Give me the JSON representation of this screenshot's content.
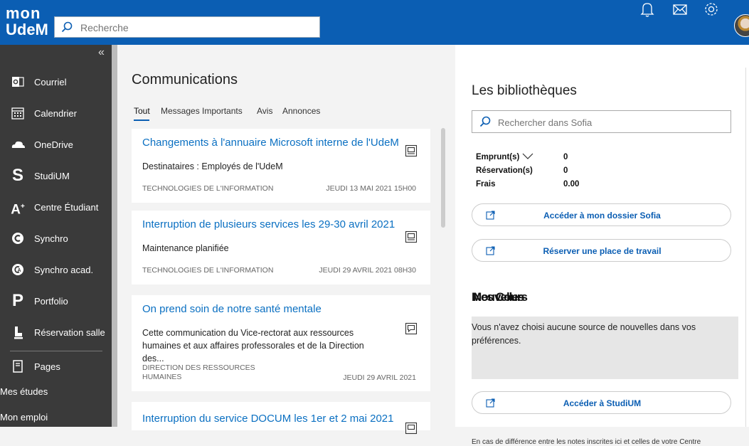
{
  "header": {
    "logo_line1": "mon",
    "logo_line2": "UdeM",
    "search_placeholder": "Recherche",
    "icons": [
      "bell-icon",
      "mail-icon",
      "gear-icon"
    ]
  },
  "sidebar": {
    "collapse_glyph": "«",
    "items": [
      {
        "label": "Courriel",
        "icon": "outlook-icon"
      },
      {
        "label": "Calendrier",
        "icon": "calendar-icon"
      },
      {
        "label": "OneDrive",
        "icon": "cloud-icon"
      },
      {
        "label": "StudiUM",
        "icon": "s-icon"
      },
      {
        "label": "Centre Étudiant",
        "icon": "a-plus-icon"
      },
      {
        "label": "Synchro",
        "icon": "synchro-icon"
      },
      {
        "label": "Synchro acad.",
        "icon": "synchro-acad-icon"
      },
      {
        "label": "Portfolio",
        "icon": "p-icon"
      },
      {
        "label": "Réservation salle",
        "icon": "reservation-icon"
      },
      {
        "label": "Pages",
        "icon": "pages-icon"
      }
    ],
    "plain_items": [
      "Mes études",
      "Mon emploi"
    ]
  },
  "communications": {
    "title": "Communications",
    "tabs": [
      "Tout",
      "Messages Importants",
      "Avis",
      "Annonces"
    ],
    "active_tab": "Tout",
    "cards": [
      {
        "title": "Changements à l'annuaire Microsoft interne de l'UdeM",
        "desc": "Destinataires : Employés de l'UdeM",
        "source": "TECHNOLOGIES DE L'INFORMATION",
        "date": "JEUDI 13 MAI 2021 15H00",
        "icon": "computer-icon"
      },
      {
        "title": "Interruption de plusieurs services les 29-30 avril 2021",
        "desc": "Maintenance planifiée",
        "source": "TECHNOLOGIES DE L'INFORMATION",
        "date": "JEUDI 29 AVRIL 2021 08H30",
        "icon": "computer-icon"
      },
      {
        "title": "On prend soin de notre santé mentale",
        "desc": "Cette communication du Vice-rectorat aux ressources humaines et aux affaires professorales et de la Direction des...",
        "source_line1": "DIRECTION DES RESSOURCES",
        "source_line2": "HUMAINES",
        "date": "JEUDI 29 AVRIL 2021",
        "icon": "chat-icon"
      },
      {
        "title": "Interruption du service DOCUM les 1er et 2 mai 2021",
        "icon": "computer-icon"
      }
    ]
  },
  "libraries": {
    "title": "Les bibliothèques",
    "search_placeholder": "Rechercher dans Sofia",
    "stats": [
      {
        "label": "Emprunt(s)",
        "value": "0",
        "has_dropdown": true
      },
      {
        "label": "Réservation(s)",
        "value": "0"
      },
      {
        "label": "Frais",
        "value": "0.00"
      }
    ],
    "buttons": [
      "Accéder à mon dossier Sofia",
      "Réserver une place de travail"
    ]
  },
  "news": {
    "title": "Mes Cours / Nouvelles",
    "title_overlap_a": "Mes Cours",
    "title_overlap_b": "Nouvelles",
    "empty_text": "Vous n'avez choisi aucune source de nouvelles dans vos préférences.",
    "studium_button": "Accéder à StudiUM",
    "footnote": "En cas de différence entre les notes inscrites ici et celles de votre Centre"
  }
}
